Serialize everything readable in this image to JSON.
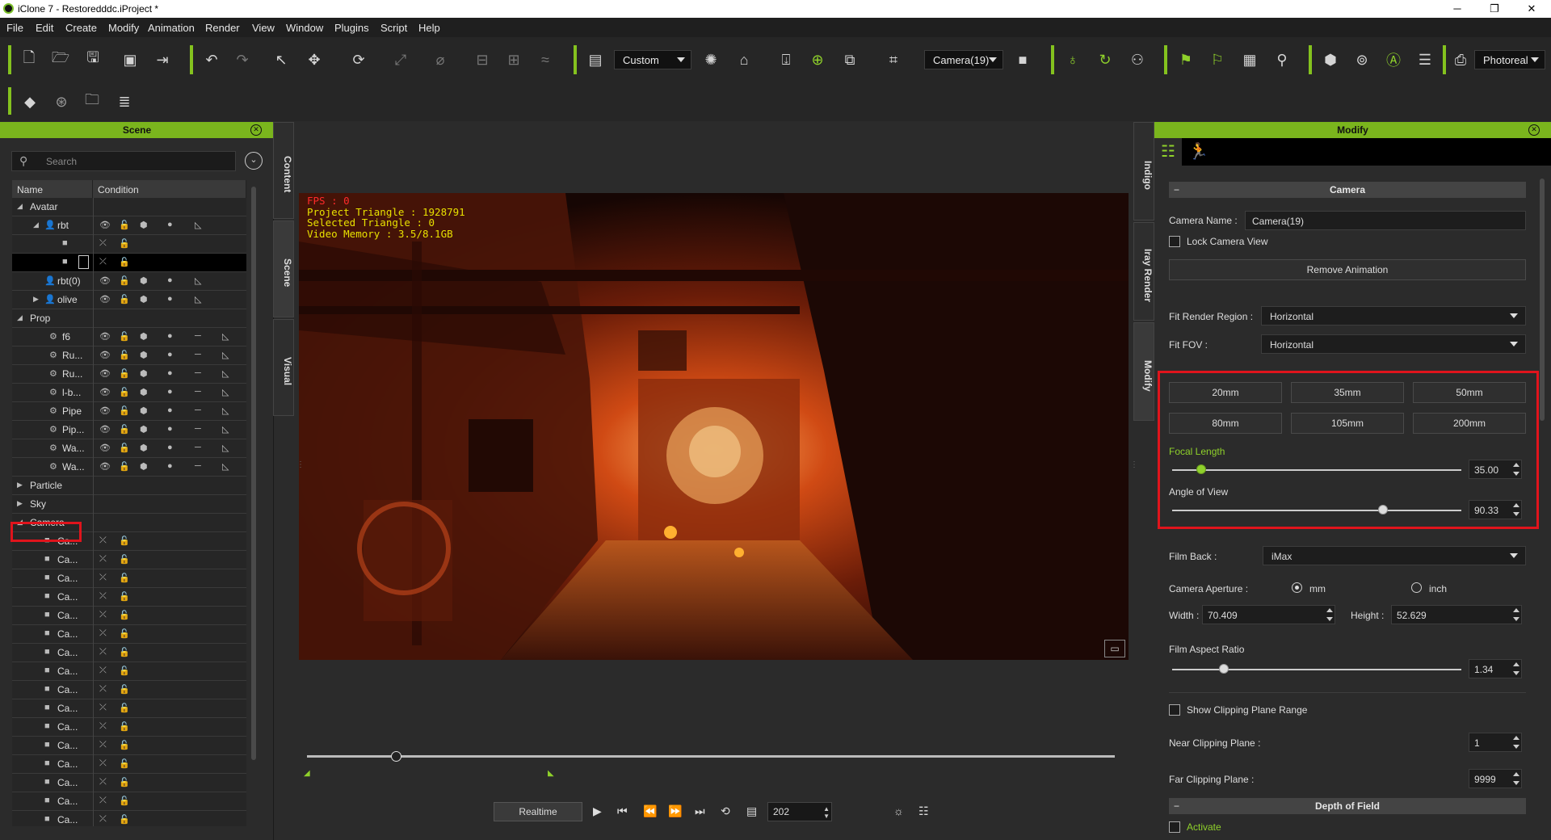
{
  "title": "iClone 7 - Restoredddc.iProject *",
  "menu": [
    "File",
    "Edit",
    "Create",
    "Modify",
    "Animation",
    "Render",
    "View",
    "Window",
    "Plugins",
    "Script",
    "Help"
  ],
  "toolbar": {
    "preset": "Custom",
    "camera": "Camera(19)",
    "render_mode": "Photoreal"
  },
  "scene": {
    "header": "Scene",
    "search_placeholder": "Search",
    "col_name": "Name",
    "col_condition": "Condition",
    "groups": {
      "avatar": "Avatar",
      "prop": "Prop",
      "particle": "Particle",
      "sky": "Sky",
      "camera": "Camera"
    },
    "avatars": [
      "rbt",
      "rbt(0)",
      "olive"
    ],
    "props": [
      "f6",
      "Ru...",
      "Ru...",
      "l-b...",
      "Pipe",
      "Pip...",
      "Wa...",
      "Wa..."
    ],
    "camera_item": "Ca..."
  },
  "side_tabs_left": [
    "Content",
    "Scene",
    "Visual"
  ],
  "side_tabs_right": [
    "Indigo",
    "Iray Render",
    "Modify"
  ],
  "hud": {
    "fps": "FPS : 0",
    "triangles": "Project Triangle : 1928791",
    "selected": "Selected Triangle : 0",
    "memory": "Video Memory : 3.5/8.1GB"
  },
  "playback": {
    "mode": "Realtime",
    "frame": "202",
    "timeline_position": 0.11
  },
  "modify": {
    "header": "Modify",
    "section_camera": "Camera",
    "camera_name_label": "Camera Name :",
    "camera_name": "Camera(19)",
    "lock_view_label": "Lock Camera View",
    "remove_anim_label": "Remove Animation",
    "fit_region_label": "Fit Render Region :",
    "fit_region": "Horizontal",
    "fit_fov_label": "Fit FOV :",
    "fit_fov": "Horizontal",
    "lenses": [
      "20mm",
      "35mm",
      "50mm",
      "80mm",
      "105mm",
      "200mm"
    ],
    "focal_length_label": "Focal Length",
    "focal_length": "35.00",
    "focal_slider": 0.1,
    "aov_label": "Angle of View",
    "aov": "90.33",
    "aov_slider": 0.73,
    "film_back_label": "Film Back :",
    "film_back": "iMax",
    "aperture_label": "Camera Aperture :",
    "unit_mm": "mm",
    "unit_inch": "inch",
    "width_label": "Width :",
    "width": "70.409",
    "height_label": "Height :",
    "height": "52.629",
    "aspect_label": "Film Aspect Ratio",
    "aspect": "1.34",
    "aspect_slider": 0.18,
    "clip_range_label": "Show Clipping Plane Range",
    "near_label": "Near Clipping Plane :",
    "near": "1",
    "far_label": "Far Clipping Plane :",
    "far": "9999",
    "section_dof": "Depth of Field",
    "activate_label": "Activate"
  },
  "colors": {
    "accent": "#7ab51d",
    "highlight": "#e0141c"
  }
}
